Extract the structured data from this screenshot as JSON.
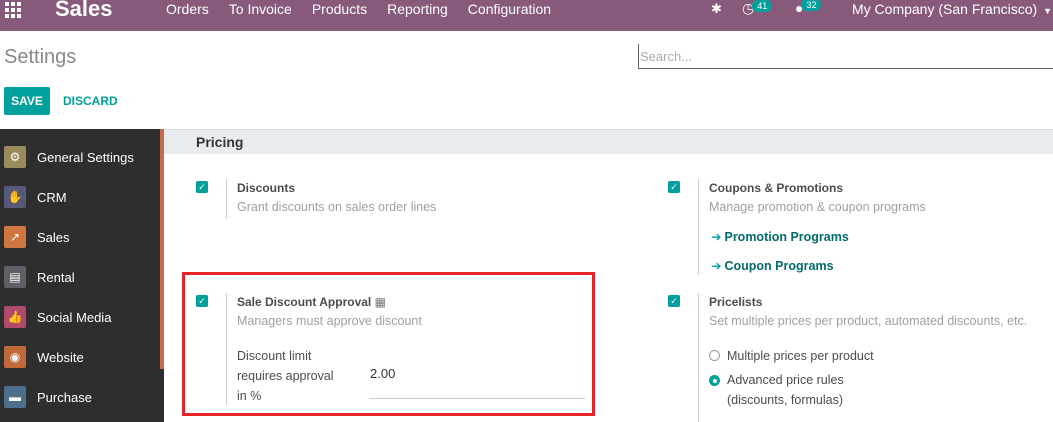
{
  "navbar": {
    "brand": "Sales",
    "menu": [
      "Orders",
      "To Invoice",
      "Products",
      "Reporting",
      "Configuration"
    ],
    "activity_count": "41",
    "message_count": "32",
    "company": "My Company (San Francisco)"
  },
  "control_panel": {
    "title": "Settings",
    "search_placeholder": "Search...",
    "save_label": "SAVE",
    "discard_label": "DISCARD"
  },
  "sidebar": {
    "items": [
      {
        "label": "General Settings",
        "icon": "gear-icon",
        "color": "#9a8c5a"
      },
      {
        "label": "CRM",
        "icon": "handshake-icon",
        "color": "#565a78"
      },
      {
        "label": "Sales",
        "icon": "chart-icon",
        "color": "#d0763e"
      },
      {
        "label": "Rental",
        "icon": "card-icon",
        "color": "#5e5f67"
      },
      {
        "label": "Social Media",
        "icon": "thumbs-up-icon",
        "color": "#b04a6c"
      },
      {
        "label": "Website",
        "icon": "globe-icon",
        "color": "#c2693a"
      },
      {
        "label": "Purchase",
        "icon": "credit-card-icon",
        "color": "#4d6f8b"
      }
    ]
  },
  "pricing": {
    "section_title": "Pricing",
    "discounts": {
      "title": "Discounts",
      "desc": "Grant discounts on sales order lines"
    },
    "coupons": {
      "title": "Coupons & Promotions",
      "desc": "Manage promotion & coupon programs",
      "link1": "Promotion Programs",
      "link2": "Coupon Programs"
    },
    "approval": {
      "title": "Sale Discount Approval",
      "desc": "Managers must approve discount",
      "label_line1": "Discount limit",
      "label_line2": "requires approval",
      "label_line3": "in %",
      "value": "2.00"
    },
    "pricelists": {
      "title": "Pricelists",
      "desc": "Set multiple prices per product, automated discounts, etc.",
      "option1": "Multiple prices per product",
      "option2_line1": "Advanced price rules",
      "option2_line2": "(discounts, formulas)"
    }
  },
  "colors": {
    "navbar": "#875a7b",
    "primary": "#00a09d",
    "highlight": "#e52427"
  }
}
